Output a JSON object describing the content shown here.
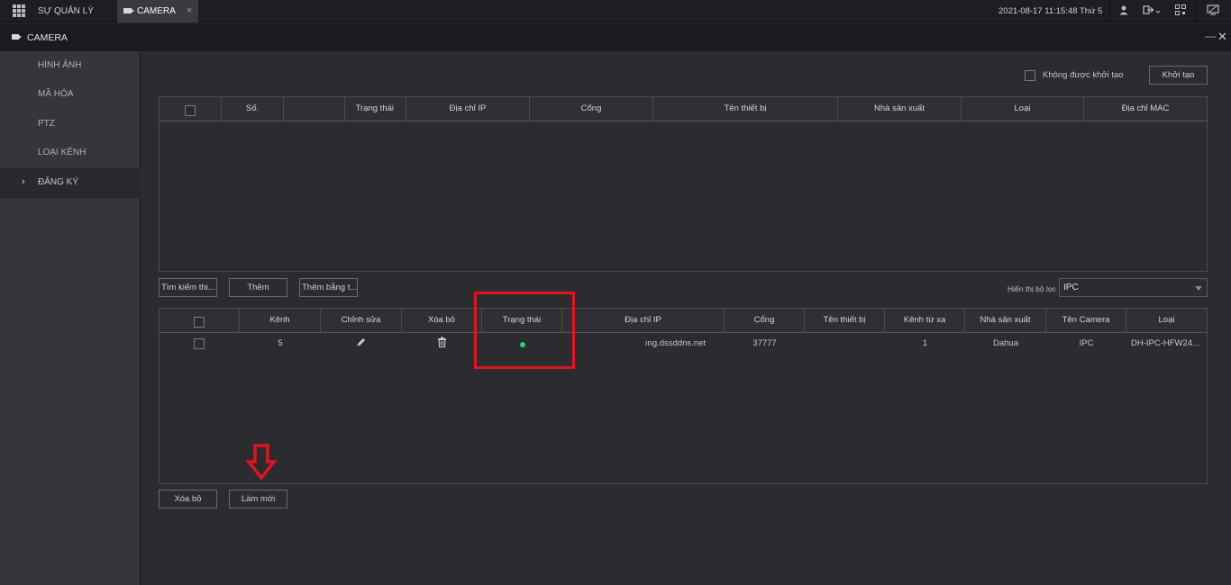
{
  "topbar": {
    "menu_label": "SỰ QUẢN LÝ",
    "tab_label": "CAMERA",
    "tab_close": "×",
    "datetime": "2021-08-17 11:15:48 Thứ 5"
  },
  "window": {
    "title": "CAMERA",
    "minimize": "—",
    "close": "✕"
  },
  "sidebar": {
    "items": [
      {
        "label": "HÌNH ẢNH"
      },
      {
        "label": "MÃ HÓA"
      },
      {
        "label": "PTZ"
      },
      {
        "label": "LOẠI KÊNH"
      },
      {
        "label": "ĐĂNG KÝ",
        "active": true
      }
    ],
    "chevron": "›"
  },
  "top_controls": {
    "checkbox_label": "Không được khởi tạo",
    "init_button": "Khởi tạo"
  },
  "device_table": {
    "headers": [
      "",
      "Số.",
      "",
      "Trạng thái",
      "Địa chỉ IP",
      "Cổng",
      "Tên thiết bị",
      "Nhà sản xuất",
      "Loại",
      "Địa chỉ MAC"
    ],
    "rows": []
  },
  "mid_controls": {
    "search_button": "Tìm kiếm thi...",
    "add_button": "Thêm",
    "add_manual_button": "Thêm bằng t...",
    "filter_label": "Hiển thị bộ lọc",
    "filter_value": "IPC"
  },
  "added_table": {
    "headers": [
      "",
      "Kênh",
      "Chỉnh sửa",
      "Xóa bỏ",
      "Trạng thái",
      "Địa chỉ IP",
      "Cổng",
      "Tên thiết bị",
      "Kênh từ xa",
      "Nhà sản xuất",
      "Tên Camera",
      "Loại"
    ],
    "rows": [
      {
        "channel": "5",
        "status": "online",
        "ip": "ıng.dssddns.net",
        "port": "37777",
        "device_name": "",
        "remote_channel": "1",
        "manufacturer": "Dahua",
        "camera_name": "IPC",
        "type": "DH-IPC-HFW24..."
      }
    ]
  },
  "bottom_controls": {
    "delete_button": "Xóa bỏ",
    "refresh_button": "Làm mới"
  },
  "colors": {
    "status_online": "#2ecc71",
    "highlight": "#e0141c"
  }
}
